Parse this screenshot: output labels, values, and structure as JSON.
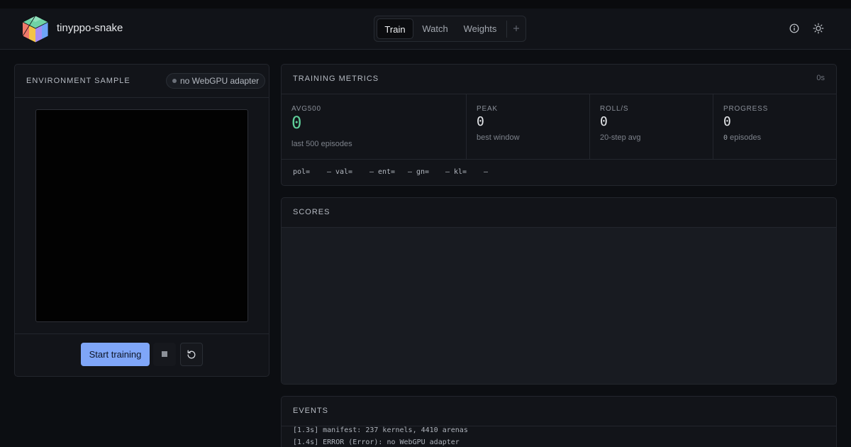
{
  "app": {
    "title": "tinyppo-snake"
  },
  "tabs": [
    {
      "label": "Train",
      "active": true
    },
    {
      "label": "Watch",
      "active": false
    },
    {
      "label": "Weights",
      "active": false
    }
  ],
  "header_icons": [
    "info-icon",
    "theme-toggle-icon"
  ],
  "environment": {
    "title": "ENVIRONMENT SAMPLE",
    "badge": "no WebGPU adapter",
    "start_label": "Start training"
  },
  "metrics": {
    "title": "TRAINING METRICS",
    "elapsed": "0s",
    "avg500": {
      "label": "AVG500",
      "value": "0",
      "sub": "last 500 episodes"
    },
    "peak": {
      "label": "PEAK",
      "value": "0",
      "sub": "best window"
    },
    "rolls": {
      "label": "ROLL/S",
      "value": "0",
      "sub": "20-step avg"
    },
    "progress": {
      "label": "PROGRESS",
      "value": "0",
      "episodes_count": "0",
      "episodes_label": "episodes"
    },
    "stats": [
      {
        "label": "pol=",
        "value": "–"
      },
      {
        "label": "val=",
        "value": "–"
      },
      {
        "label": "ent=",
        "value": "–"
      },
      {
        "label": "gn=",
        "value": "–"
      },
      {
        "label": "kl=",
        "value": "–"
      }
    ]
  },
  "scores": {
    "title": "SCORES"
  },
  "events": {
    "title": "EVENTS",
    "lines": [
      "[1.3s] manifest: 237 kernels, 4410 arenas",
      "[1.4s] ERROR (Error): no WebGPU adapter"
    ]
  },
  "colors": {
    "accent": "#7fa6f8",
    "success": "#5fcf9a",
    "background": "#0c0e12"
  }
}
